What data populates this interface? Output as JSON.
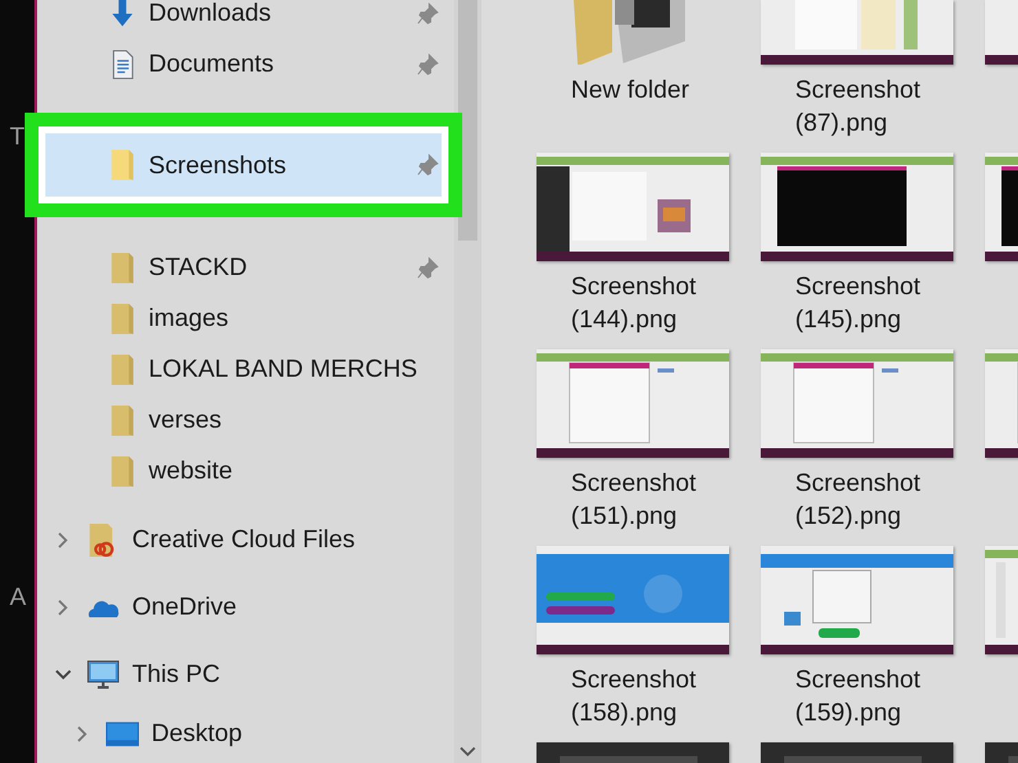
{
  "desktop_labels": [
    "T",
    "A"
  ],
  "sidebar": {
    "quick_access_items": [
      {
        "label": "Downloads",
        "kind": "download",
        "pinned": true,
        "selected": false
      },
      {
        "label": "Documents",
        "kind": "documents",
        "pinned": true,
        "selected": false
      },
      {
        "label": "Screenshots",
        "kind": "folder",
        "pinned": true,
        "selected": true
      },
      {
        "label": "STACKD",
        "kind": "folder",
        "pinned": true,
        "selected": false
      },
      {
        "label": "images",
        "kind": "folder",
        "pinned": false,
        "selected": false
      },
      {
        "label": "LOKAL BAND MERCHS",
        "kind": "folder",
        "pinned": false,
        "selected": false
      },
      {
        "label": "verses",
        "kind": "folder",
        "pinned": false,
        "selected": false
      },
      {
        "label": "website",
        "kind": "folder",
        "pinned": false,
        "selected": false
      }
    ],
    "nodes": [
      {
        "label": "Creative Cloud Files",
        "kind": "sync-folder",
        "expanded": false
      },
      {
        "label": "OneDrive",
        "kind": "cloud",
        "expanded": false
      },
      {
        "label": "This PC",
        "kind": "computer",
        "expanded": true,
        "children": [
          {
            "label": "Desktop",
            "kind": "desktop",
            "expanded": false
          }
        ]
      }
    ]
  },
  "files": [
    {
      "name": "New folder",
      "kind": "folder"
    },
    {
      "name": "Screenshot (87).png",
      "kind": "picture"
    },
    {
      "kind": "picture"
    },
    {
      "name": "Screenshot (144).png",
      "kind": "picture"
    },
    {
      "name": "Screenshot (145).png",
      "kind": "picture"
    },
    {
      "kind": "picture"
    },
    {
      "name": "Screenshot (151).png",
      "kind": "picture"
    },
    {
      "name": "Screenshot (152).png",
      "kind": "picture"
    },
    {
      "kind": "picture"
    },
    {
      "name": "Screenshot (158).png",
      "kind": "picture"
    },
    {
      "name": "Screenshot (159).png",
      "kind": "picture"
    },
    {
      "kind": "picture"
    },
    {
      "kind": "picture"
    },
    {
      "kind": "picture"
    },
    {
      "kind": "picture"
    }
  ]
}
